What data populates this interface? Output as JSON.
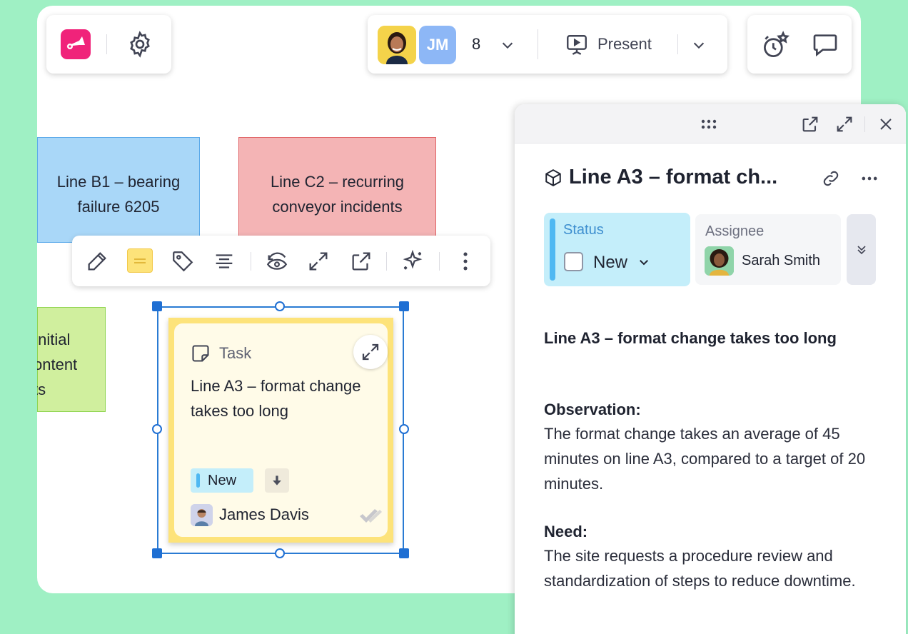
{
  "toolbar": {
    "user_count": "8",
    "avatar_initials": "JM",
    "present_label": "Present"
  },
  "canvas": {
    "sticky_b1": {
      "line1": "Line B1 – bearing",
      "line2": "failure 6205"
    },
    "sticky_c2": {
      "line1": "Line C2 – recurring",
      "line2": "conveyor incidents"
    },
    "sticky_green": {
      "line1": "Initial",
      "line2": "ontent",
      "line3": "ts"
    }
  },
  "task_card": {
    "type_label": "Task",
    "title": "Line A3 – format change takes too long",
    "status_tag": "New",
    "assignee": "James Davis"
  },
  "panel": {
    "title": "Line A3 – format ch...",
    "status_label": "Status",
    "status_value": "New",
    "assignee_label": "Assignee",
    "assignee_name": "Sarah Smith",
    "heading": "Line A3 – format change takes too long",
    "observation_label": "Observation:",
    "observation_text": "The format change takes an average of 45 minutes on line A3, compared to a target of 20 minutes.",
    "need_label": "Need:",
    "need_text": "The site requests a procedure review and standardization of steps to reduce downtime."
  },
  "colors": {
    "background": "#9ff0c4",
    "brand_logo": "#f0237a",
    "selection": "#1f6fd3",
    "sticky_yellow": "#fde37a",
    "status_bg": "#c4eefa"
  }
}
